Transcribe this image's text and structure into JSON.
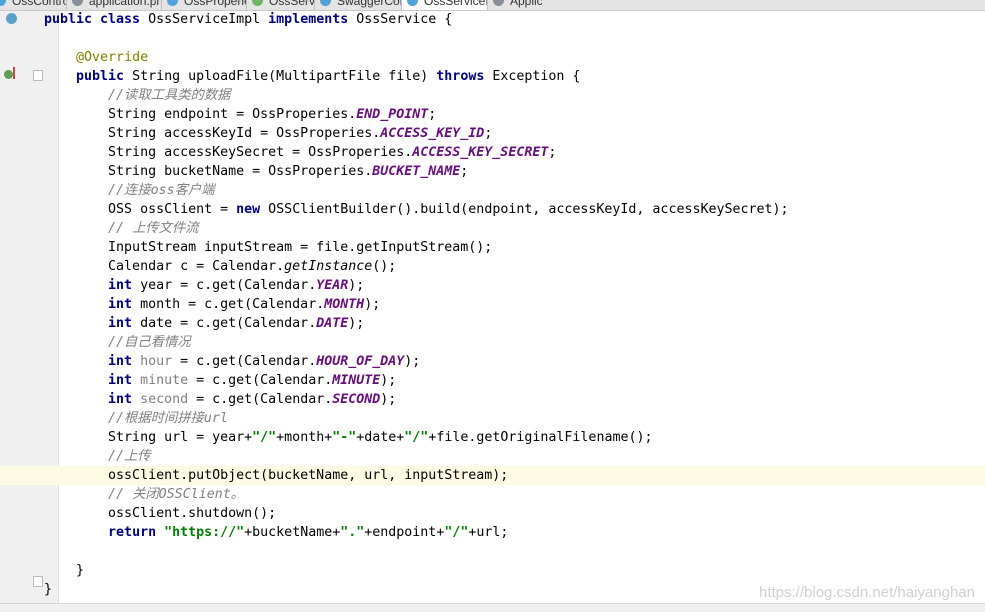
{
  "tabs": [
    {
      "label": "OssController.java",
      "icon": "class-icon",
      "active": false
    },
    {
      "label": "application.properties",
      "icon": "properties-icon",
      "active": false
    },
    {
      "label": "OssProperies.java",
      "icon": "class-icon",
      "active": false
    },
    {
      "label": "OssService.java",
      "icon": "interface-icon",
      "active": false
    },
    {
      "label": "SwaggerConfig.java",
      "icon": "class-icon",
      "active": false
    },
    {
      "label": "OssServiceImpl.java",
      "icon": "class-icon",
      "active": true
    },
    {
      "label": "Applic",
      "icon": "properties-icon",
      "active": false
    }
  ],
  "editor": {
    "highlighted_line": 24,
    "lines": [
      [
        [
          "kw",
          "public class "
        ],
        [
          "pl",
          "OssServiceImpl "
        ],
        [
          "kw",
          "implements "
        ],
        [
          "pl",
          "OssService {"
        ]
      ],
      [],
      [
        [
          "pl",
          "    "
        ],
        [
          "an",
          "@Override"
        ]
      ],
      [
        [
          "pl",
          "    "
        ],
        [
          "kw",
          "public "
        ],
        [
          "pl",
          "String uploadFile(MultipartFile file) "
        ],
        [
          "kw",
          "throws "
        ],
        [
          "pl",
          "Exception {"
        ]
      ],
      [
        [
          "pl",
          "        "
        ],
        [
          "cm",
          "//读取工具类的数据"
        ]
      ],
      [
        [
          "pl",
          "        String endpoint = OssProperies."
        ],
        [
          "st",
          "END_POINT"
        ],
        [
          "pl",
          ";"
        ]
      ],
      [
        [
          "pl",
          "        String accessKeyId = OssProperies."
        ],
        [
          "st",
          "ACCESS_KEY_ID"
        ],
        [
          "pl",
          ";"
        ]
      ],
      [
        [
          "pl",
          "        String accessKeySecret = OssProperies."
        ],
        [
          "st",
          "ACCESS_KEY_SECRET"
        ],
        [
          "pl",
          ";"
        ]
      ],
      [
        [
          "pl",
          "        String bucketName = OssProperies."
        ],
        [
          "st",
          "BUCKET_NAME"
        ],
        [
          "pl",
          ";"
        ]
      ],
      [
        [
          "pl",
          "        "
        ],
        [
          "cm",
          "//连接oss客户端"
        ]
      ],
      [
        [
          "pl",
          "        OSS ossClient = "
        ],
        [
          "kw",
          "new "
        ],
        [
          "pl",
          "OSSClientBuilder().build(endpoint, accessKeyId, accessKeySecret);"
        ]
      ],
      [
        [
          "pl",
          "        "
        ],
        [
          "cm",
          "// 上传文件流"
        ]
      ],
      [
        [
          "pl",
          "        InputStream inputStream = file.getInputStream();"
        ]
      ],
      [
        [
          "pl",
          "        Calendar c = Calendar."
        ],
        [
          "it",
          "getInstance"
        ],
        [
          "pl",
          "();"
        ]
      ],
      [
        [
          "pl",
          "        "
        ],
        [
          "kw",
          "int "
        ],
        [
          "pl",
          "year = c.get(Calendar."
        ],
        [
          "st",
          "YEAR"
        ],
        [
          "pl",
          ");"
        ]
      ],
      [
        [
          "pl",
          "        "
        ],
        [
          "kw",
          "int "
        ],
        [
          "pl",
          "month = c.get(Calendar."
        ],
        [
          "st",
          "MONTH"
        ],
        [
          "pl",
          ");"
        ]
      ],
      [
        [
          "pl",
          "        "
        ],
        [
          "kw",
          "int "
        ],
        [
          "pl",
          "date = c.get(Calendar."
        ],
        [
          "st",
          "DATE"
        ],
        [
          "pl",
          ");"
        ]
      ],
      [
        [
          "pl",
          "        "
        ],
        [
          "cm",
          "//自己看情况"
        ]
      ],
      [
        [
          "pl",
          "        "
        ],
        [
          "kw",
          "int "
        ],
        [
          "un",
          "hour"
        ],
        [
          "pl",
          " = c.get(Calendar."
        ],
        [
          "st",
          "HOUR_OF_DAY"
        ],
        [
          "pl",
          ");"
        ]
      ],
      [
        [
          "pl",
          "        "
        ],
        [
          "kw",
          "int "
        ],
        [
          "un",
          "minute"
        ],
        [
          "pl",
          " = c.get(Calendar."
        ],
        [
          "st",
          "MINUTE"
        ],
        [
          "pl",
          ");"
        ]
      ],
      [
        [
          "pl",
          "        "
        ],
        [
          "kw",
          "int "
        ],
        [
          "un",
          "second"
        ],
        [
          "pl",
          " = c.get(Calendar."
        ],
        [
          "st",
          "SECOND"
        ],
        [
          "pl",
          ");"
        ]
      ],
      [
        [
          "pl",
          "        "
        ],
        [
          "cm",
          "//根据时间拼接url"
        ]
      ],
      [
        [
          "pl",
          "        String url = year+"
        ],
        [
          "str",
          "\"/\""
        ],
        [
          "pl",
          "+month+"
        ],
        [
          "str",
          "\"-\""
        ],
        [
          "pl",
          "+date+"
        ],
        [
          "str",
          "\"/\""
        ],
        [
          "pl",
          "+file.getOriginalFilename();"
        ]
      ],
      [
        [
          "pl",
          "        "
        ],
        [
          "cm",
          "//上传"
        ]
      ],
      [
        [
          "pl",
          "        ossClient.putObject(bucketName, url, inputStream);"
        ]
      ],
      [
        [
          "pl",
          "        "
        ],
        [
          "cm",
          "// 关闭OSSClient。"
        ]
      ],
      [
        [
          "pl",
          "        ossClient.shutdown();"
        ]
      ],
      [
        [
          "pl",
          "        "
        ],
        [
          "kw",
          "return "
        ],
        [
          "str",
          "\"https://\""
        ],
        [
          "pl",
          "+bucketName+"
        ],
        [
          "str",
          "\".\""
        ],
        [
          "pl",
          "+endpoint+"
        ],
        [
          "str",
          "\"/\""
        ],
        [
          "pl",
          "+url;"
        ]
      ],
      [],
      [
        [
          "pl",
          "    }"
        ]
      ],
      [
        [
          "pl",
          "}"
        ]
      ]
    ]
  },
  "watermark": "https://blog.csdn.net/haiyanghan",
  "colors": {
    "keyword": "#000080",
    "comment": "#808080",
    "static_field": "#660e7a",
    "annotation": "#808000",
    "string": "#008000",
    "highlight_line": "#fcfae3"
  }
}
